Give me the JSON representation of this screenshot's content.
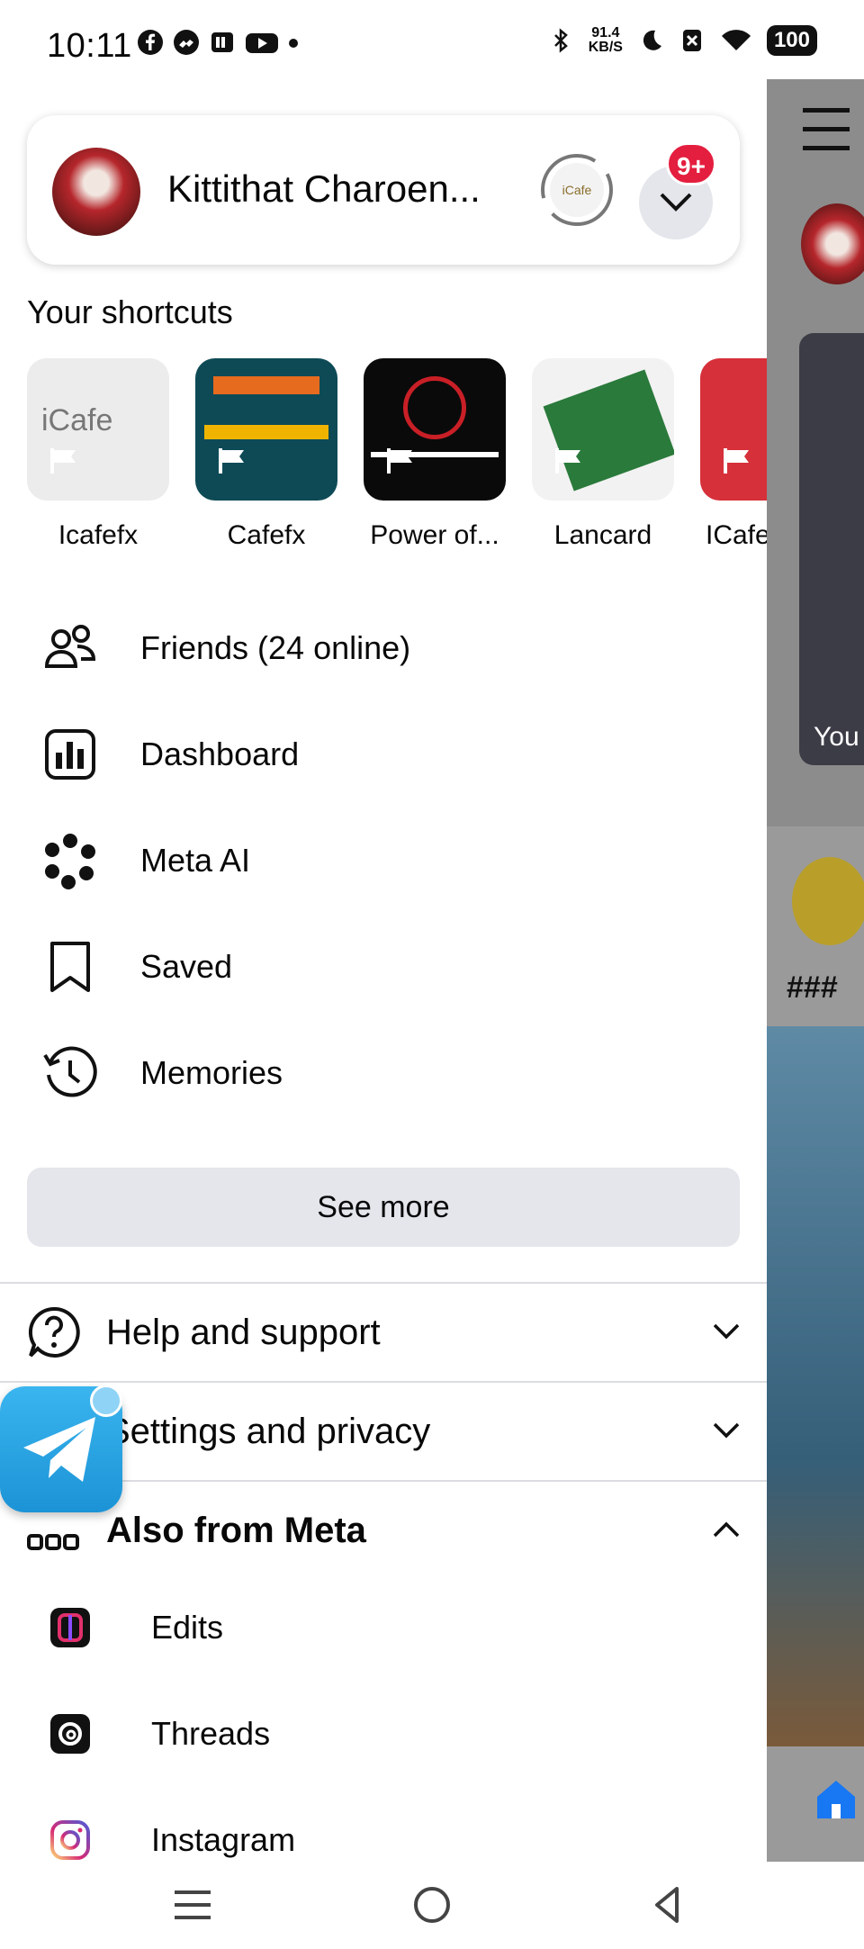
{
  "status_bar": {
    "time": "10:11",
    "net_speed_value": "91.4",
    "net_speed_unit": "KB/S",
    "battery": "100"
  },
  "profile": {
    "name": "Kittithat Charoen...",
    "notification_count": "9+"
  },
  "shortcuts": {
    "title": "Your shortcuts",
    "items": [
      {
        "label": "Icafefx"
      },
      {
        "label": "Cafefx"
      },
      {
        "label": "Power of..."
      },
      {
        "label": "Lancard"
      },
      {
        "label": "ICafe"
      }
    ]
  },
  "menu": [
    {
      "label": "Friends (24 online)",
      "icon": "friends-icon"
    },
    {
      "label": "Dashboard",
      "icon": "dashboard-icon"
    },
    {
      "label": "Meta AI",
      "icon": "meta-ai-icon"
    },
    {
      "label": "Saved",
      "icon": "bookmark-icon"
    },
    {
      "label": "Memories",
      "icon": "memories-icon"
    }
  ],
  "see_more": "See more",
  "sections": {
    "help": "Help and support",
    "settings": "Settings and privacy",
    "also_meta": "Also from Meta"
  },
  "meta_apps": [
    {
      "label": "Edits",
      "icon": "edits-icon"
    },
    {
      "label": "Threads",
      "icon": "threads-icon"
    },
    {
      "label": "Instagram",
      "icon": "instagram-icon"
    }
  ],
  "feed_peek": {
    "story_label": "You",
    "post_text": "###"
  },
  "colors": {
    "accent": "#1877f2",
    "badge": "#e41e3f",
    "button_bg": "#e4e6eb"
  }
}
